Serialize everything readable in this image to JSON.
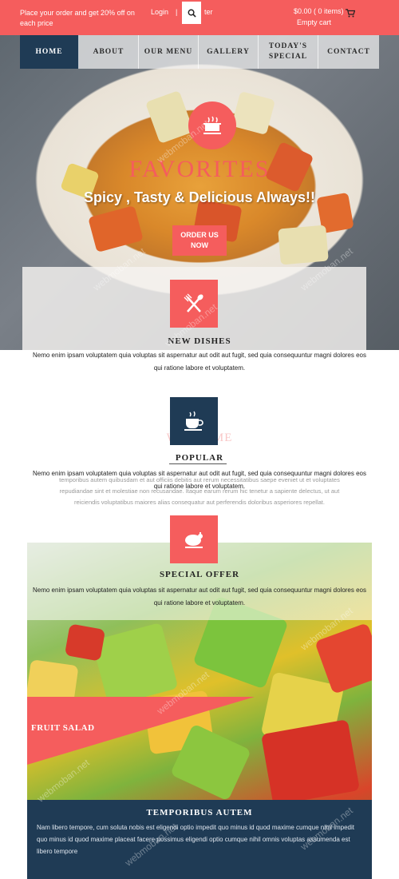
{
  "topbar": {
    "promo": "Place your order and get 20% off on",
    "promo_line2": "each price",
    "login": "Login",
    "separator": "|",
    "register": "ter",
    "cart_total": "$0.00 ( 0 items)",
    "cart_empty": "Empty cart"
  },
  "nav": {
    "items": [
      "HOME",
      "ABOUT",
      "OUR MENU",
      "GALLERY",
      "TODAY'S SPECIAL",
      "CONTACT"
    ]
  },
  "hero": {
    "title": "FAVORITES",
    "tagline": "Spicy , Tasty & Delicious Always!!",
    "order_button": "ORDER US NOW"
  },
  "sections": [
    {
      "title": "NEW DISHES",
      "text": "Nemo enim ipsam voluptatem quia voluptas sit aspernatur aut odit aut fugit, sed quia consequuntur magni dolores eos qui ratione labore et voluptatem."
    },
    {
      "title": "POPULAR",
      "text": "Nemo enim ipsam voluptatem quia voluptas sit aspernatur aut odit aut fugit, sed quia consequuntur magni dolores eos qui ratione labore et voluptatem."
    },
    {
      "title": "SPECIAL OFFER",
      "text": "Nemo enim ipsam voluptatem quia voluptas sit aspernatur aut odit aut fugit, sed quia consequuntur magni dolores eos qui ratione labore et voluptatem."
    }
  ],
  "welcome": {
    "heading": "WELCOME",
    "text": "temporibus autem quibusdam et aut officiis debitis aut rerum necessitatibus saepe eveniet ut et voluptates repudiandae sint et molestiae non recusandae. Itaque earum rerum hic tenetur a sapiente delectus, ut aut reiciendis voluptatibus maiores alias consequatur aut perferendis doloribus asperiores repellat."
  },
  "fruit": {
    "label": "FRUIT SALAD",
    "panel_title": "TEMPORIBUS AUTEM",
    "panel_text": "Nam libero tempore, cum soluta nobis est eligendi optio impedit quo minus id quod maxime cumque nihil impedit quo minus id quod maxime placeat facere possimus eligendi optio cumque nihil omnis voluptas assumenda est libero tempore"
  },
  "watermark": "webmoban.net",
  "colors": {
    "accent": "#f55d5d",
    "navy": "#1f3b55"
  }
}
